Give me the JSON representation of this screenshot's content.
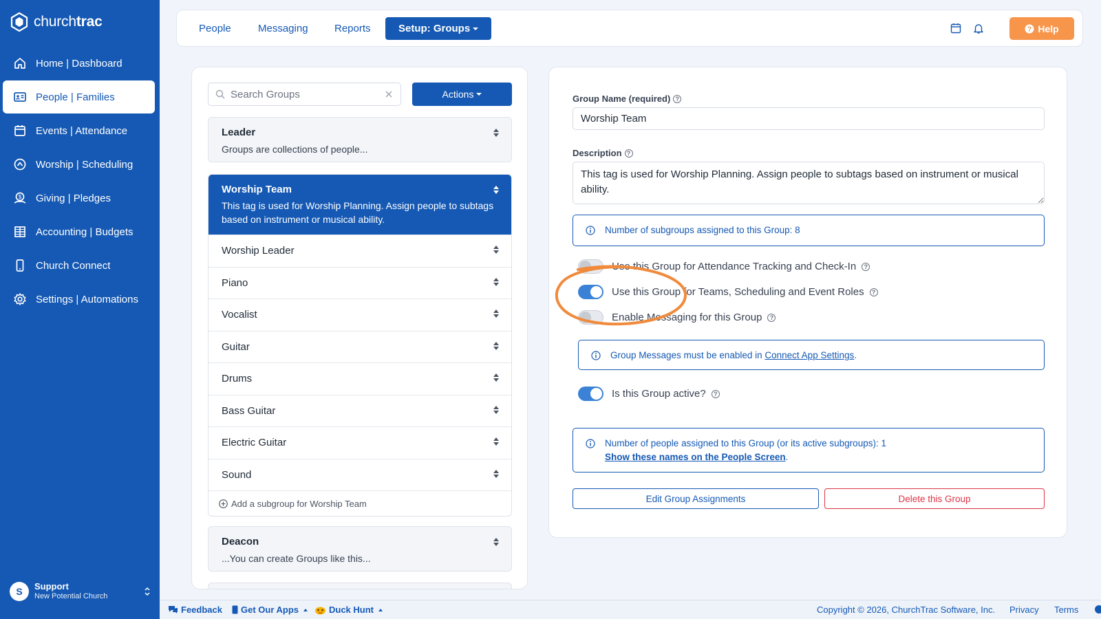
{
  "app": {
    "logo_text_church": "church",
    "logo_text_trac": "trac"
  },
  "sidebar": {
    "items": [
      {
        "label": "Home | Dashboard",
        "icon": "home-icon"
      },
      {
        "label": "People | Families",
        "icon": "id-card-icon",
        "active": true
      },
      {
        "label": "Events | Attendance",
        "icon": "calendar-icon"
      },
      {
        "label": "Worship | Scheduling",
        "icon": "music-icon"
      },
      {
        "label": "Giving | Pledges",
        "icon": "giving-icon"
      },
      {
        "label": "Accounting | Budgets",
        "icon": "grid-icon"
      },
      {
        "label": "Church Connect",
        "icon": "phone-icon"
      },
      {
        "label": "Settings | Automations",
        "icon": "gear-icon"
      }
    ],
    "user": {
      "initial": "S",
      "name": "Support",
      "org": "New Potential Church"
    }
  },
  "topbar": {
    "tabs": [
      "People",
      "Messaging",
      "Reports"
    ],
    "active_tab": "Setup: Groups",
    "help_label": "Help"
  },
  "groups": {
    "search_placeholder": "Search Groups",
    "actions_label": "Actions",
    "leader": {
      "title": "Leader",
      "desc": "Groups are collections of people..."
    },
    "worship_team": {
      "title": "Worship Team",
      "desc": "This tag is used for Worship Planning. Assign people to subtags based on instrument or musical ability."
    },
    "subgroups": [
      "Worship Leader",
      "Piano",
      "Vocalist",
      "Guitar",
      "Drums",
      "Bass Guitar",
      "Electric Guitar",
      "Sound"
    ],
    "add_subgroup": "Add a subgroup for Worship Team",
    "deacon": {
      "title": "Deacon",
      "desc": "...You can create Groups like this..."
    }
  },
  "detail": {
    "name_label": "Group Name (required)",
    "name_value": "Worship Team",
    "desc_label": "Description",
    "desc_value": "This tag is used for Worship Planning. Assign people to subtags based on instrument or musical ability.",
    "subgroups_info": "Number of subgroups assigned to this Group: 8",
    "toggles": [
      {
        "label": "Use this Group for Attendance Tracking and Check-In",
        "on": false
      },
      {
        "label": "Use this Group for Teams, Scheduling and Event Roles",
        "on": true
      },
      {
        "label": "Enable Messaging for this Group",
        "on": false
      }
    ],
    "messages_info_prefix": "Group Messages must be enabled in ",
    "messages_info_link": "Connect App Settings",
    "messages_info_suffix": ".",
    "active_label": "Is this Group active?",
    "active_on": true,
    "people_info": "Number of people assigned to this Group (or its active subgroups): 1",
    "people_link": "Show these names on the People Screen",
    "people_link_suffix": ".",
    "edit_button": "Edit Group Assignments",
    "delete_button": "Delete this Group",
    "annotation_color": "#f08a3c"
  },
  "footer": {
    "feedback": "Feedback",
    "apps": "Get Our Apps",
    "duck": "Duck Hunt",
    "copyright": "Copyright © 2026, ChurchTrac Software, Inc.",
    "privacy": "Privacy",
    "terms": "Terms"
  },
  "colors": {
    "primary": "#1559b4",
    "help": "#f7954a",
    "danger": "#dc3545"
  }
}
